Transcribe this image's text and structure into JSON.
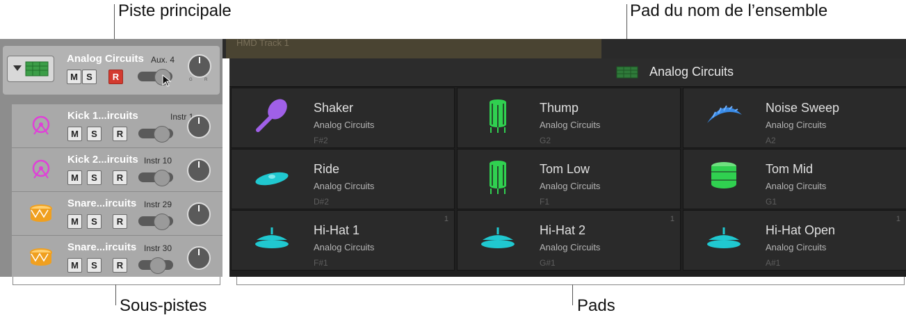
{
  "callouts": {
    "main_track": "Piste principale",
    "kit_name_pad": "Pad du nom de l’ensemble",
    "subtracks": "Sous-pistes",
    "pads": "Pads"
  },
  "region": {
    "label": "HMD Track 1"
  },
  "main_track": {
    "name": "Analog Circuits",
    "channel": "Aux. 4",
    "buttons": {
      "mute": "M",
      "solo": "S",
      "record": "R"
    },
    "knob_labels": {
      "g": "G",
      "r": "R"
    }
  },
  "subtracks": [
    {
      "name": "Kick 1...ircuits",
      "channel": "Instr 1",
      "icon": "kick-drum-icon",
      "icon_color": "#e040d8"
    },
    {
      "name": "Kick 2...ircuits",
      "channel": "Instr 10",
      "icon": "kick-drum-icon",
      "icon_color": "#e040d8"
    },
    {
      "name": "Snare...ircuits",
      "channel": "Instr 29",
      "icon": "snare-drum-icon",
      "icon_color": "#f0a020"
    },
    {
      "name": "Snare...ircuits",
      "channel": "Instr 30",
      "icon": "snare-drum-icon",
      "icon_color": "#f0a020"
    }
  ],
  "buttons": {
    "mute": "M",
    "solo": "S",
    "record": "R"
  },
  "kit": {
    "name": "Analog Circuits",
    "icon": "drum-machine-icon"
  },
  "pads": [
    {
      "name": "Shaker",
      "kit": "Analog Circuits",
      "note": "F#2",
      "num": "",
      "icon": "maraca-icon",
      "color": "#a060e8"
    },
    {
      "name": "Thump",
      "kit": "Analog Circuits",
      "note": "G2",
      "num": "",
      "icon": "tom-drum-icon",
      "color": "#30d050"
    },
    {
      "name": "Noise Sweep",
      "kit": "Analog Circuits",
      "note": "A2",
      "num": "",
      "icon": "sweep-icon",
      "color": "#3a8ce8"
    },
    {
      "name": "Ride",
      "kit": "Analog Circuits",
      "note": "D#2",
      "num": "",
      "icon": "ride-cymbal-icon",
      "color": "#20c8d0"
    },
    {
      "name": "Tom Low",
      "kit": "Analog Circuits",
      "note": "F1",
      "num": "",
      "icon": "tom-drum-icon",
      "color": "#30d050"
    },
    {
      "name": "Tom Mid",
      "kit": "Analog Circuits",
      "note": "G1",
      "num": "",
      "icon": "drum-icon",
      "color": "#30d050"
    },
    {
      "name": "Hi-Hat 1",
      "kit": "Analog Circuits",
      "note": "F#1",
      "num": "1",
      "icon": "hihat-icon",
      "color": "#20c8d0"
    },
    {
      "name": "Hi-Hat 2",
      "kit": "Analog Circuits",
      "note": "G#1",
      "num": "1",
      "icon": "hihat-icon",
      "color": "#20c8d0"
    },
    {
      "name": "Hi-Hat Open",
      "kit": "Analog Circuits",
      "note": "A#1",
      "num": "1",
      "icon": "hihat-icon",
      "color": "#20c8d0"
    }
  ]
}
